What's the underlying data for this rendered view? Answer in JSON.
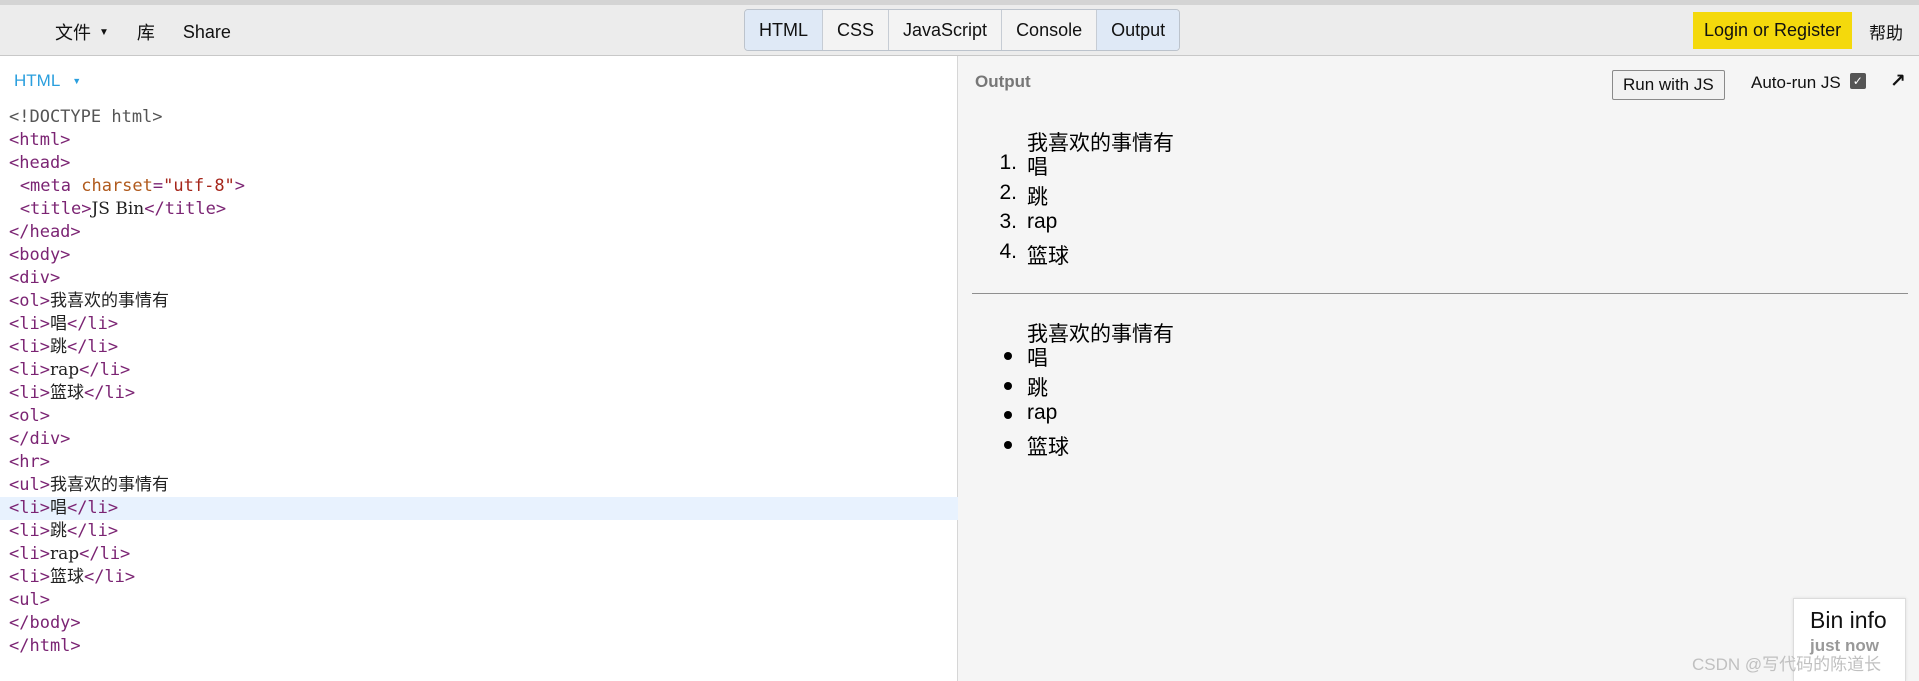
{
  "toolbar": {
    "menu": [
      {
        "label": "文件",
        "has_caret": true
      },
      {
        "label": "库",
        "has_caret": false
      },
      {
        "label": "Share",
        "has_caret": false
      }
    ],
    "panels": [
      {
        "label": "HTML",
        "active": true
      },
      {
        "label": "CSS",
        "active": false
      },
      {
        "label": "JavaScript",
        "active": false
      },
      {
        "label": "Console",
        "active": false
      },
      {
        "label": "Output",
        "active": true
      }
    ],
    "login_label": "Login or Register",
    "help_label": "帮助"
  },
  "editor": {
    "panel_label": "HTML",
    "highlighted_line": 17,
    "lines": [
      "<!DOCTYPE html>",
      "<html>",
      "<head>",
      "  <meta charset=\"utf-8\">",
      "  <title>JS Bin</title>",
      "</head>",
      "<body>",
      "<div>",
      "<ol>我喜欢的事情有",
      "<li>唱</li>",
      "<li>跳</li>",
      "<li>rap</li>",
      "<li>篮球</li>",
      "<ol>",
      "</div>",
      "<hr>",
      "<ul>我喜欢的事情有",
      "<li>唱</li>",
      "<li>跳</li>",
      "<li>rap</li>",
      "<li>篮球</li>",
      "<ul>",
      "</body>",
      "</html>"
    ]
  },
  "output": {
    "panel_label": "Output",
    "run_label": "Run with JS",
    "autorun_label": "Auto-run JS",
    "autorun_checked": true,
    "ordered_heading": "我喜欢的事情有",
    "ordered_items": [
      "唱",
      "跳",
      "rap",
      "篮球"
    ],
    "unordered_heading": "我喜欢的事情有",
    "unordered_items": [
      "唱",
      "跳",
      "rap",
      "篮球"
    ],
    "bin_info_title": "Bin info",
    "bin_info_sub": "just now"
  },
  "icons": {
    "caret": "caret-down-icon",
    "checkbox": "check-icon",
    "popout": "popout-arrow-icon"
  },
  "watermark": "CSDN @写代码的陈道长",
  "colors": {
    "accent_blue": "#2a9fde",
    "login_yellow": "#f4d90c",
    "tag_purple": "#7b2473",
    "highlight_line": "#e8f2fe"
  }
}
